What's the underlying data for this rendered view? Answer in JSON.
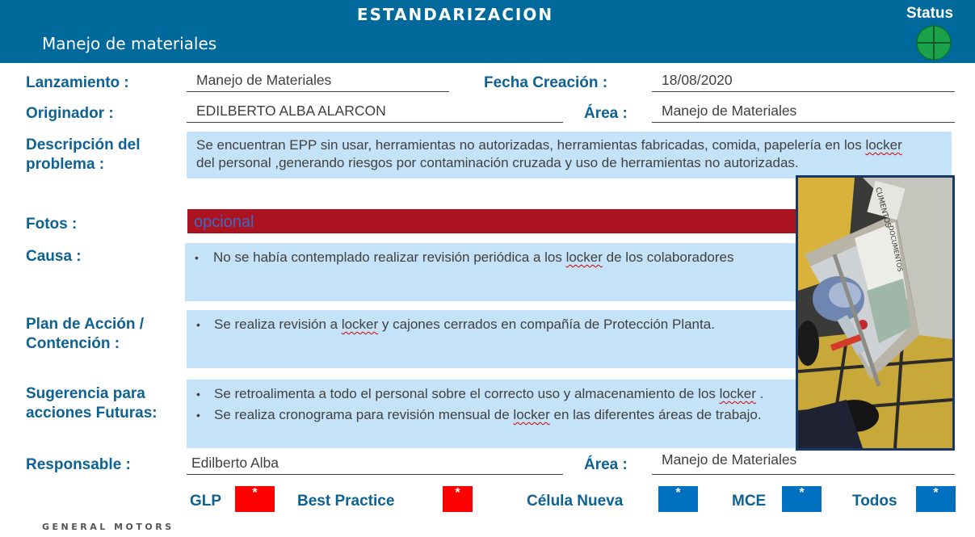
{
  "header": {
    "title": "ESTANDARIZACION",
    "subtitle": "Manejo de materiales",
    "status_label": "Status",
    "status_color": "#1aa34a"
  },
  "fields": {
    "lanzamiento_label": "Lanzamiento :",
    "lanzamiento_value": "Manejo de Materiales",
    "fecha_label": "Fecha Creación :",
    "fecha_value": "18/08/2020",
    "originador_label": "Originador :",
    "originador_value": "EDILBERTO ALBA ALARCON",
    "area_label": "Área :",
    "area_value": "Manejo de Materiales",
    "descripcion_label_1": "Descripción del",
    "descripcion_label_2": "problema :",
    "descripcion_text_1a": "Se encuentran EPP sin usar, herramientas no autorizadas, herramientas fabricadas, comida, papelería en los ",
    "descripcion_text_1b": "locker",
    "descripcion_text_2": "del personal ,generando riesgos por contaminación cruzada y uso de herramientas no autorizadas.",
    "fotos_label": "Fotos :",
    "fotos_placeholder": "opcional",
    "causa_label": "Causa :",
    "causa_a": "No se había contemplado realizar revisión periódica a los ",
    "causa_b": "locker",
    "causa_c": " de los colaboradores",
    "plan_label_1": "Plan de Acción /",
    "plan_label_2": "Contención :",
    "plan_a": "Se realiza revisión a ",
    "plan_b": "locker",
    "plan_c": " y cajones cerrados en compañía de Protección Planta.",
    "sugerencia_label_1": "Sugerencia para",
    "sugerencia_label_2": "acciones  Futuras:",
    "sug1_a": "Se retroalimenta a todo el personal sobre el correcto uso y almacenamiento de los ",
    "sug1_b": "locker",
    "sug1_c": " .",
    "sug2_a": "Se realiza cronograma para revisión mensual de ",
    "sug2_b": "locker",
    "sug2_c": " en las diferentes áreas de trabajo.",
    "responsable_label": "Responsable :",
    "responsable_value": "Edilberto Alba",
    "area2_label": "Área :",
    "area2_value": "Manejo de Materiales"
  },
  "photo": {
    "box_text_1": "CUMENTOS",
    "box_text_2": "DOCUMENTOS"
  },
  "categories": [
    {
      "label": "GLP",
      "mark": "*",
      "color": "#ff0000"
    },
    {
      "label": "Best Practice",
      "mark": "*",
      "color": "#ff0000"
    },
    {
      "label": "Célula Nueva",
      "mark": "*",
      "color": "#0070c0"
    },
    {
      "label": "MCE",
      "mark": "*",
      "color": "#0070c0"
    },
    {
      "label": "Todos",
      "mark": "*",
      "color": "#0070c0"
    }
  ],
  "footer": {
    "logo_text": "GENERAL MOTORS"
  }
}
